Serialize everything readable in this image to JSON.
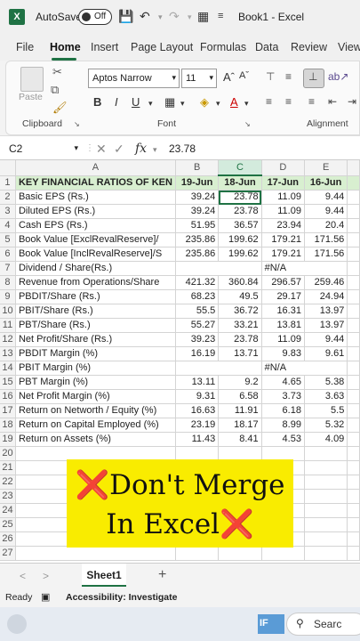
{
  "titlebar": {
    "app_badge": "X",
    "autosave_label": "AutoSave",
    "autosave_state": "Off",
    "doc_title": "Book1 - Excel"
  },
  "tabs": [
    "File",
    "Home",
    "Insert",
    "Page Layout",
    "Formulas",
    "Data",
    "Review",
    "View"
  ],
  "ribbon": {
    "paste_label": "Paste",
    "clipboard_label": "Clipboard",
    "font_label": "Font",
    "alignment_label": "Alignment",
    "font_name": "Aptos Narrow",
    "font_size": "11"
  },
  "formula_bar": {
    "name_box": "C2",
    "fx": "fx",
    "value": "23.78"
  },
  "columns": [
    "A",
    "B",
    "C",
    "D",
    "E"
  ],
  "rows": [
    [
      "KEY FINANCIAL RATIOS OF KEN",
      "19-Jun",
      "18-Jun",
      "17-Jun",
      "16-Jun"
    ],
    [
      "Basic EPS (Rs.)",
      "39.24",
      "23.78",
      "11.09",
      "9.44"
    ],
    [
      "Diluted EPS (Rs.)",
      "39.24",
      "23.78",
      "11.09",
      "9.44"
    ],
    [
      "Cash EPS (Rs.)",
      "51.95",
      "36.57",
      "23.94",
      "20.4"
    ],
    [
      "Book Value [ExclRevalReserve]/",
      "235.86",
      "199.62",
      "179.21",
      "171.56"
    ],
    [
      "Book Value [InclRevalReserve]/S",
      "235.86",
      "199.62",
      "179.21",
      "171.56"
    ],
    [
      "Dividend / Share(Rs.)",
      "",
      "",
      "#N/A",
      ""
    ],
    [
      "Revenue from Operations/Share",
      "421.32",
      "360.84",
      "296.57",
      "259.46"
    ],
    [
      "PBDIT/Share (Rs.)",
      "68.23",
      "49.5",
      "29.17",
      "24.94"
    ],
    [
      "PBIT/Share (Rs.)",
      "55.5",
      "36.72",
      "16.31",
      "13.97"
    ],
    [
      "PBT/Share (Rs.)",
      "55.27",
      "33.21",
      "13.81",
      "13.97"
    ],
    [
      "Net Profit/Share (Rs.)",
      "39.23",
      "23.78",
      "11.09",
      "9.44"
    ],
    [
      "PBDIT Margin (%)",
      "16.19",
      "13.71",
      "9.83",
      "9.61"
    ],
    [
      "PBIT Margin (%)",
      "",
      "",
      "#N/A",
      ""
    ],
    [
      "PBT Margin (%)",
      "13.11",
      "9.2",
      "4.65",
      "5.38"
    ],
    [
      "Net Profit Margin (%)",
      "9.31",
      "6.58",
      "3.73",
      "3.63"
    ],
    [
      "Return on Networth / Equity (%)",
      "16.63",
      "11.91",
      "6.18",
      "5.5"
    ],
    [
      "Return on Capital Employed (%)",
      "23.19",
      "18.17",
      "8.99",
      "5.32"
    ],
    [
      "Return on Assets (%)",
      "11.43",
      "8.41",
      "4.53",
      "4.09"
    ],
    [
      "",
      "",
      "",
      "",
      ""
    ],
    [
      "",
      "",
      "",
      "",
      ""
    ],
    [
      "",
      "",
      "",
      "",
      ""
    ],
    [
      "",
      "",
      "",
      "",
      ""
    ],
    [
      "",
      "",
      "",
      "",
      ""
    ],
    [
      "",
      "",
      "",
      "",
      ""
    ],
    [
      "",
      "",
      "",
      "",
      ""
    ],
    [
      "",
      "",
      "",
      "",
      ""
    ]
  ],
  "overlay": {
    "line1": "Don't Merge",
    "line2": "In Excel",
    "x_glyph": "❌"
  },
  "sheetbar": {
    "sheet_name": "Sheet1",
    "add": "+"
  },
  "status": {
    "ready": "Ready",
    "accessibility": "Accessibility: Investigate"
  },
  "taskbar": {
    "search": "Searc"
  }
}
